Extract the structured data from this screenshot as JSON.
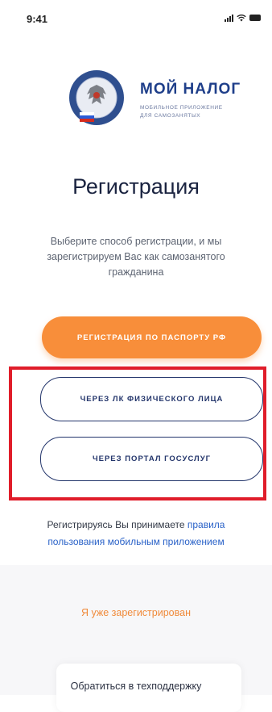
{
  "status_bar": {
    "time": "9:41"
  },
  "brand": {
    "title": "МОЙ НАЛОГ",
    "subtitle_line1": "МОБИЛЬНОЕ ПРИЛОЖЕНИЕ",
    "subtitle_line2": "ДЛЯ САМОЗАНЯТЫХ",
    "logo_icon": "fns-emblem-icon",
    "colors": {
      "brand_blue": "#1f3f8a",
      "seal_ring": "#2f4f8f"
    }
  },
  "page": {
    "title": "Регистрация",
    "subtitle_line1": "Выберите способ регистрации, и мы",
    "subtitle_line2": "зарегистрируем Вас как самозанятого",
    "subtitle_line3": "гражданина"
  },
  "buttons": {
    "passport": "РЕГИСТРАЦИЯ ПО ПАСПОРТУ РФ",
    "lk": "ЧЕРЕЗ ЛК ФИЗИЧЕСКОГО ЛИЦА",
    "gosuslugi": "ЧЕРЕЗ ПОРТАЛ ГОСУСЛУГ"
  },
  "terms": {
    "prefix": "Регистрируясь Вы принимаете ",
    "link_part1": "правила",
    "link_part2": "пользования мобильным приложением"
  },
  "footer": {
    "already_registered": "Я уже зарегистрирован",
    "support": "Обратиться в техподдержку"
  },
  "colors": {
    "accent_orange": "#f88e3a",
    "outline_navy": "#23356b",
    "highlight_red": "#e01d2a",
    "link_blue": "#2a62c8"
  }
}
